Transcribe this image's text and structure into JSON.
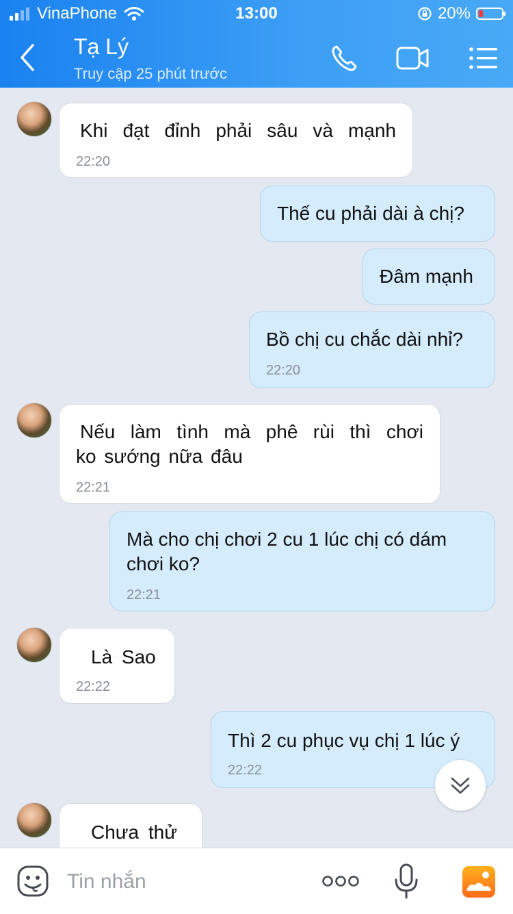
{
  "status_bar": {
    "carrier": "VinaPhone",
    "time": "13:00",
    "battery": "20%",
    "battery_level": 0.2,
    "icons": [
      "signal-icon",
      "wifi-icon",
      "rotation-lock-icon",
      "battery-icon"
    ]
  },
  "header": {
    "title": "Tạ Lý",
    "subtitle": "Truy cập 25 phút trước",
    "icons": [
      "back-icon",
      "phone-call-icon",
      "video-call-icon",
      "menu-list-icon"
    ]
  },
  "messages": [
    {
      "side": "in",
      "lines": [
        "Khi đạt đỉnh phải sâu và mạnh"
      ],
      "time": "22:20"
    },
    {
      "side": "out",
      "lines": [
        "Thế cu phải dài à chị?"
      ],
      "time": ""
    },
    {
      "side": "out",
      "lines": [
        "Đâm mạnh"
      ],
      "time": ""
    },
    {
      "side": "out",
      "lines": [
        "Bồ chị cu chắc dài nhỉ?"
      ],
      "time": "22:20"
    },
    {
      "side": "in",
      "lines": [
        "Nếu làm tình mà phê rùi thì chơi",
        "ko sướng nữa đâu"
      ],
      "time": "22:21"
    },
    {
      "side": "out",
      "lines": [
        "Mà cho chị chơi 2 cu 1 lúc chị có dám",
        "chơi ko?"
      ],
      "time": "22:21"
    },
    {
      "side": "in",
      "lines": [
        "Là Sao"
      ],
      "time": "22:22"
    },
    {
      "side": "out",
      "lines": [
        "Thì 2 cu phục vụ chị 1 lúc ý"
      ],
      "time": "22:22"
    },
    {
      "side": "in",
      "lines": [
        "Chưa thử"
      ],
      "time": ""
    }
  ],
  "input": {
    "placeholder": "Tin nhắn",
    "icons": [
      "emoji-icon",
      "more-options-icon",
      "microphone-icon",
      "gallery-icon"
    ]
  },
  "colors": {
    "header_blue": "#1a82f0",
    "chat_background": "#e3e8f1",
    "incoming_bubble": "#ffffff",
    "outgoing_bubble": "#d5ecfc"
  }
}
